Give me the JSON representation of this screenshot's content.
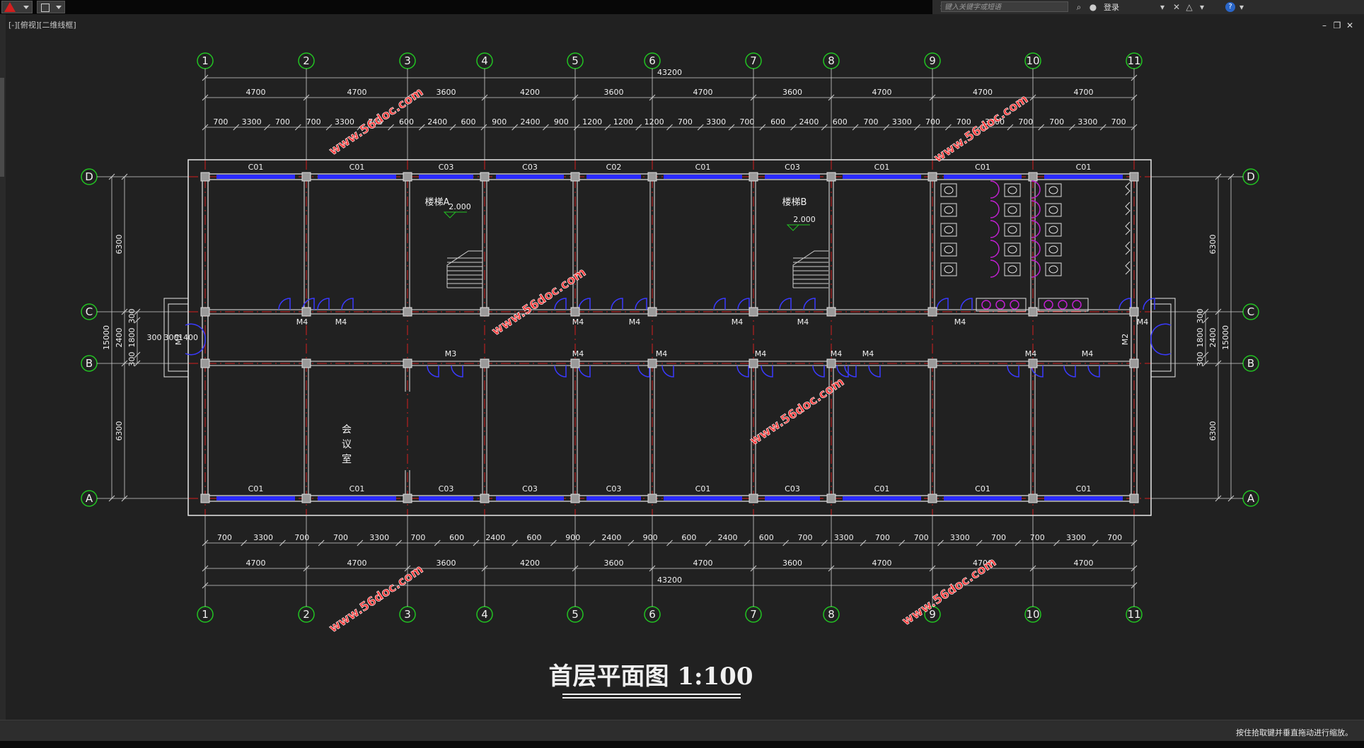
{
  "app": {
    "search_placeholder": "键入关键字或短语",
    "login_label": "登录",
    "viewport_label": "[-][俯视][二维线框]"
  },
  "status": {
    "hint": "按住拾取键并垂直拖动进行缩放。"
  },
  "drawing": {
    "title": "首层平面图 1:100",
    "axes_x": [
      "1",
      "2",
      "3",
      "4",
      "5",
      "6",
      "7",
      "8",
      "9",
      "10",
      "11"
    ],
    "axes_y": [
      "D",
      "C",
      "B",
      "A"
    ],
    "overall_width": "43200",
    "bay_dims": [
      "4700",
      "4700",
      "3600",
      "4200",
      "3600",
      "4700",
      "3600",
      "4700",
      "4700",
      "4700"
    ],
    "top_detail_dims": [
      "700",
      "3300",
      "700",
      "700",
      "3300",
      "700",
      "600",
      "2400",
      "600",
      "900",
      "2400",
      "900",
      "1200",
      "1200",
      "1200",
      "700",
      "3300",
      "700",
      "600",
      "2400",
      "600",
      "700",
      "3300",
      "700",
      "700",
      "3300",
      "700",
      "700",
      "3300",
      "700"
    ],
    "bottom_detail_dims": [
      "700",
      "3300",
      "700",
      "700",
      "3300",
      "700",
      "600",
      "2400",
      "600",
      "900",
      "2400",
      "900",
      "600",
      "2400",
      "600",
      "700",
      "3300",
      "700",
      "700",
      "3300",
      "700",
      "700",
      "3300",
      "700"
    ],
    "top_windows": [
      "C01",
      "C01",
      "C03",
      "C03",
      "C02",
      "C01",
      "C03",
      "C01",
      "C01",
      "C01"
    ],
    "bottom_windows": [
      "C01",
      "C01",
      "C03",
      "C03",
      "C03",
      "C01",
      "C03",
      "C01",
      "C01",
      "C01"
    ],
    "doors_c": [
      "M4",
      "M4",
      "M4",
      "M4",
      "M4",
      "M4",
      "M4",
      "M4"
    ],
    "doors_b": [
      "M3",
      "M4",
      "M4",
      "M4",
      "M4",
      "M4",
      "M4",
      "M4"
    ],
    "entrance_door": "M2",
    "stair_a": "楼梯A",
    "stair_b": "楼梯B",
    "elev_a": "2.000",
    "elev_b": "2.000",
    "meeting_room": [
      "会",
      "议",
      "室"
    ],
    "side_dims_outer": "15000",
    "side_dims_rows": [
      "6300",
      "2400",
      "6300"
    ],
    "side_dims_corridor": [
      "300",
      "1800",
      "300"
    ],
    "entry_dims": [
      "300",
      "300",
      "1400"
    ],
    "watermark": "www.56doc.com",
    "colors": {
      "axis_circle": "#22c322",
      "wall": "#e8e8e8",
      "window": "#2a2aff",
      "axis_line": "#d22020",
      "door": "#3a3aff",
      "fixture": "#c020d0"
    }
  }
}
